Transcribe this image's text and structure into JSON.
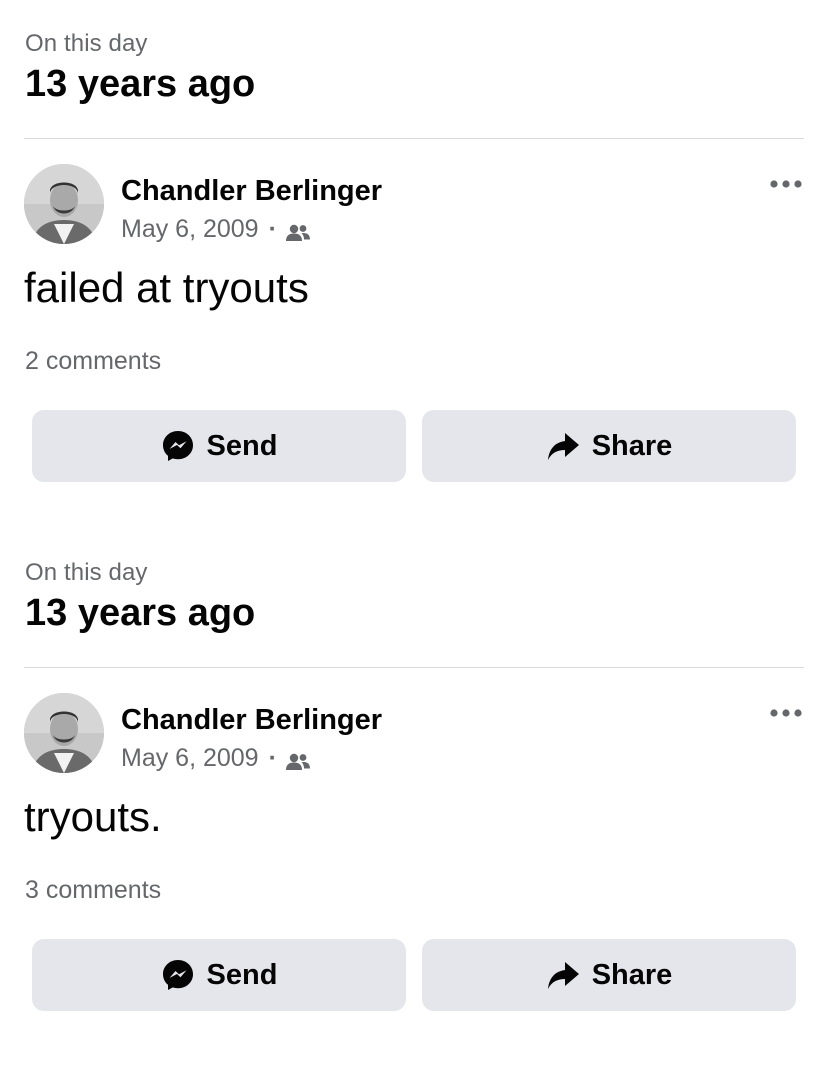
{
  "memories": [
    {
      "eyebrow": "On this day",
      "years": "13 years ago",
      "author": "Chandler Berlinger",
      "date": "May 6, 2009",
      "audience_icon": "friends-icon",
      "text": "failed at tryouts",
      "comments": "2 comments",
      "send_label": "Send",
      "share_label": "Share"
    },
    {
      "eyebrow": "On this day",
      "years": "13 years ago",
      "author": "Chandler Berlinger",
      "date": "May 6, 2009",
      "audience_icon": "friends-icon",
      "text": "tryouts.",
      "comments": "3 comments",
      "send_label": "Send",
      "share_label": "Share"
    }
  ],
  "colors": {
    "text_primary": "#050505",
    "text_secondary": "#65676b",
    "button_bg": "#e4e6eb",
    "separator": "#c9ccd1"
  }
}
